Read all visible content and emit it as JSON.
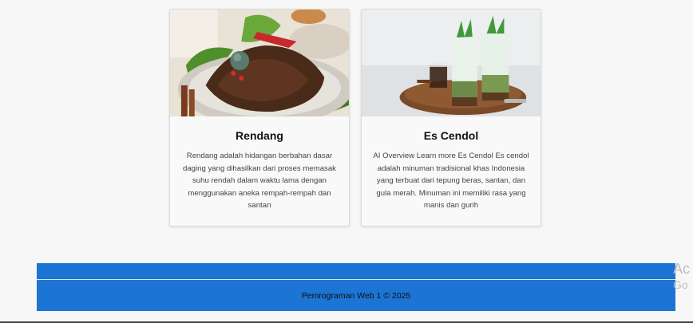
{
  "cards": [
    {
      "title": "Rendang",
      "description": "Rendang adalah hidangan berbahan dasar daging yang dihasilkan dari proses memasak suhu rendah dalam waktu lama dengan menggunakan aneka rempah-rempah dan santan",
      "image_alt": "rendang-photo"
    },
    {
      "title": "Es Cendol",
      "description": "AI Overview Learn more Es Cendol Es cendol adalah minuman tradisional khas Indonesia yang terbuat dari tepung beras, santan, dan gula merah. Minuman ini memiliki rasa yang manis dan gurih",
      "image_alt": "es-cendol-photo"
    }
  ],
  "footer": {
    "text": "Pemrograman Web 1 © 2025"
  },
  "watermark": {
    "line1": "Ac",
    "line2": "Go"
  },
  "colors": {
    "footer_bg": "#1c74d4",
    "page_bg": "#f7f7f7"
  }
}
